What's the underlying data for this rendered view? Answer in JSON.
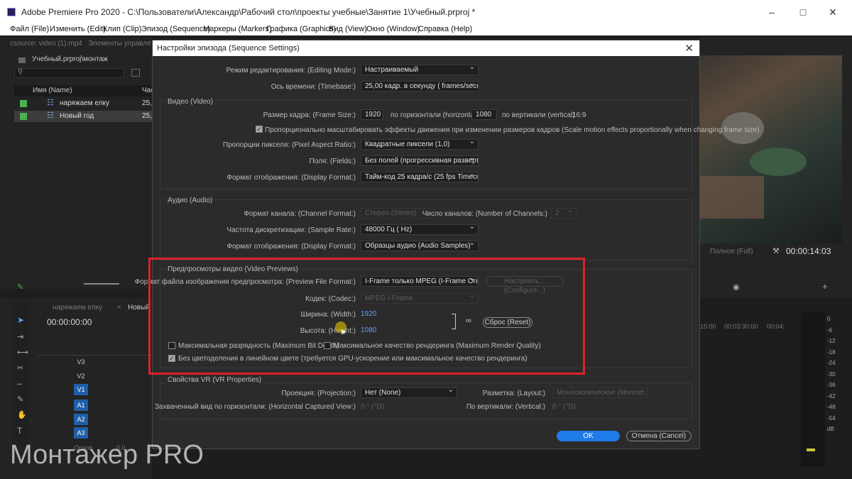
{
  "window": {
    "title": "Adobe Premiere Pro 2020 - C:\\Пользователи\\Александр\\Рабочий стол\\проекты учебные\\Занятие 1\\Учебный.prproj *"
  },
  "menu": [
    "Файл (File)",
    "Изменить (Edit)",
    "Клип (Clip)",
    "Эпизод (Sequence)",
    "Маркеры (Markers)",
    "Графика (Graphics)",
    "Вид (View)",
    "Окно (Window)",
    "Справка (Help)"
  ],
  "project_panel": {
    "tab_source": "сsource: video (1).mp4",
    "tab_effects": "Элементы управле",
    "path": "Учебный.prproj\\монтаж",
    "col_name": "Имя (Name)",
    "col_rate": "Час",
    "items": [
      {
        "name": "наряжаем елку",
        "rate": "25,"
      },
      {
        "name": "Новый год",
        "rate": "25,"
      }
    ]
  },
  "timeline": {
    "tab1": "наряжаем елку",
    "tab2": "Новый",
    "timecode": "00:00:00:00",
    "video_tracks": [
      "V3",
      "V2",
      "V1"
    ],
    "audio_tracks": [
      "A1",
      "A2",
      "A3"
    ],
    "master_label": "Основ",
    "master_value": "0.0",
    "ruler": [
      "15:00",
      "00:03:30:00",
      "00:04:"
    ]
  },
  "program_monitor": {
    "quality": "Полное (Full)",
    "timecode": "00:00:14:03"
  },
  "meter_labels": [
    "0",
    "-6",
    "-12",
    "-18",
    "-24",
    "-30",
    "-36",
    "-42",
    "-48",
    "-54",
    "dB"
  ],
  "dialog": {
    "title": "Настройки эпизода (Sequence Settings)",
    "editing_mode_label": "Режим редактирования: (Editing Mode:)",
    "editing_mode_value": "Настраиваемый",
    "timebase_label": "Ось времени: (Timebase:)",
    "timebase_value": "25,00 кадр. в секунду ( frames/seco...",
    "video": {
      "title": "Видео (Video)",
      "frame_size_label": "Размер кадра: (Frame Size:)",
      "width": "1920",
      "horizontal": "по горизонтали (horizontal)",
      "height": "1080",
      "vertical": "по вертикали (vertical)",
      "aspect": "16:9",
      "scale_checkbox": "Пропорционально масштабировать эффекты движения при изменении размеров кадров (Scale motion effects proportionally when changing frame size)",
      "par_label": "Пропорции пикселя: (Pixel Aspect Ratio:)",
      "par_value": "Квадратные пиксели (1,0)",
      "fields_label": "Поля: (Fields:)",
      "fields_value": "Без полей (прогрессивная развертка)",
      "display_label": "Формат отображения: (Display Format:)",
      "display_value": "Тайм-код 25 кадра/с (25 fps Timeco..."
    },
    "audio": {
      "title": "Аудио (Audio)",
      "channel_label": "Формат канала: (Channel Format:)",
      "channel_value": "Стерео (Stereo)",
      "num_channels_label": "Число каналов: (Number of Channels:)",
      "num_channels_value": "2",
      "sample_rate_label": "Частота дискретизации: (Sample Rate:)",
      "sample_rate_value": "48000 Гц ( Hz)",
      "display_label": "Формат отображения: (Display Format:)",
      "display_value": "Образцы аудио (Audio Samples)"
    },
    "previews": {
      "title": "Предпросмотры видео (Video Previews)",
      "format_label": "Формат файла изображения предпросмотра: (Preview File Format:)",
      "format_value": "I-Frame только MPEG (I-Frame Only...",
      "configure": "Настроить... (Configure...)",
      "codec_label": "Кодек: (Codec:)",
      "codec_value": "MPEG I-Frame",
      "width_label": "Ширина: (Width:)",
      "width_value": "1920",
      "height_label": "Высота: (Height:)",
      "height_value": "1080",
      "reset": "Сброс (Reset)",
      "max_bit_depth": "Максимальная разрядность (Maximum Bit Depth)",
      "max_render_quality": "Максимальное качество рендеринга (Maximum Render Quality)",
      "linear_color": "Без цветоделения в линейном цвете (требуется GPU-ускорение или максимальное качество рендеринга)"
    },
    "vr": {
      "title": "Свойства VR (VR Properties)",
      "projection_label": "Проекция: (Projection:)",
      "projection_value": "Нет (None)",
      "layout_label": "Разметка: (Layout:)",
      "layout_value": "Моноскопическое (Monosc...",
      "hcap_label": "Захваченный вид по горизонтали: (Horizontal Captured View:)",
      "hcap_value": "0 ° (°D)",
      "vert_label": "По вертикали: (Vertical:)",
      "vert_value": "0 ° (°D)"
    },
    "ok": "OK",
    "cancel": "Отмена (Cancel)"
  },
  "watermark": "Монтажер PRO"
}
